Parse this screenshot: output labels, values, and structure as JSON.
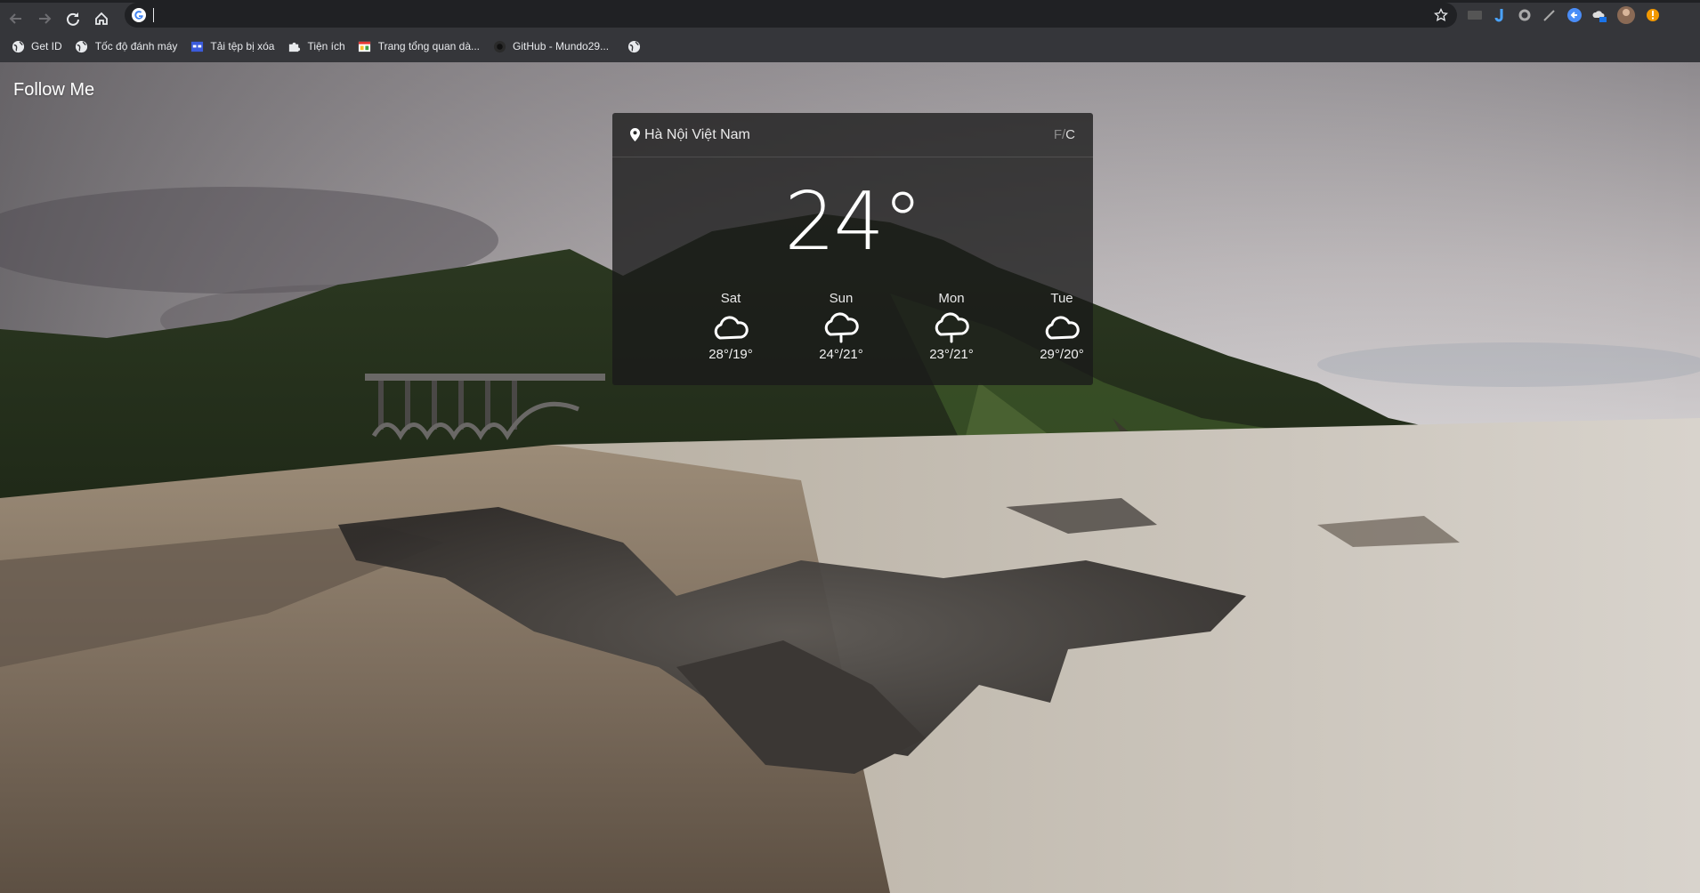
{
  "browser": {
    "address_value": "",
    "bookmarks": [
      {
        "label": "Get ID",
        "icon": "globe-icon"
      },
      {
        "label": "Tốc độ đánh máy",
        "icon": "globe-icon"
      },
      {
        "label": "Tải tệp bị xóa",
        "icon": "window-icon"
      },
      {
        "label": "Tiện ích",
        "icon": "puzzle-icon"
      },
      {
        "label": "Trang tổng quan dà...",
        "icon": "dashboard-icon"
      },
      {
        "label": "GitHub - Mundo29...",
        "icon": "github-icon"
      },
      {
        "label": "",
        "icon": "globe-icon"
      }
    ],
    "extension_labels": {
      "ext1": "SRX"
    }
  },
  "page": {
    "follow_me": "Follow Me"
  },
  "weather": {
    "location": "Hà Nội Việt Nam",
    "unit_f": "F",
    "unit_sep": "/",
    "unit_c": "C",
    "current_temp": "24°",
    "forecast": [
      {
        "day": "Sat",
        "range": "28°/19°",
        "icon": "cloud-icon"
      },
      {
        "day": "Sun",
        "range": "24°/21°",
        "icon": "rain-cloud-icon"
      },
      {
        "day": "Mon",
        "range": "23°/21°",
        "icon": "rain-cloud-icon"
      },
      {
        "day": "Tue",
        "range": "29°/20°",
        "icon": "cloud-icon"
      }
    ]
  },
  "colors": {
    "chrome_bg": "#35363a",
    "omnibox_bg": "#202124",
    "widget_bg": "rgba(25,25,25,0.78)"
  }
}
